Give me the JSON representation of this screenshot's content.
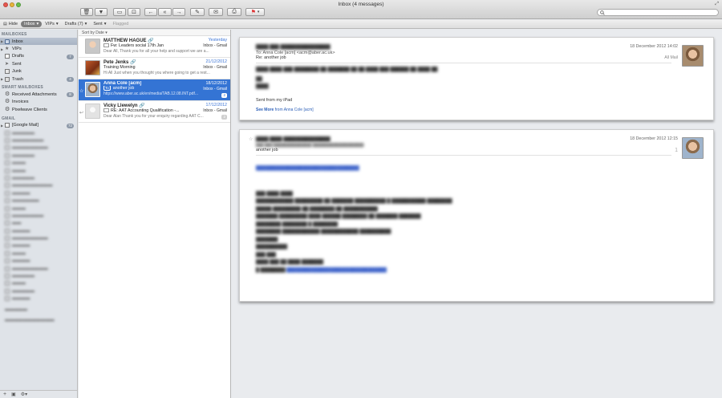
{
  "window": {
    "title": "Inbox (4 messages)"
  },
  "toolbar": {
    "buttons": [
      "delete",
      "junk",
      "archive",
      "archive-box",
      "reply",
      "reply-all",
      "forward",
      "compose",
      "envelope",
      "print",
      "flag"
    ]
  },
  "favorites": {
    "hide": "Hide",
    "inbox": "Inbox",
    "vips": "VIPs",
    "drafts": "Drafts (7)",
    "sent": "Sent",
    "flagged": "Flagged"
  },
  "sidebar": {
    "mailboxes_header": "MAILBOXES",
    "mailboxes": [
      {
        "label": "Inbox",
        "icon": "tray-icon",
        "badge": ""
      },
      {
        "label": "VIPs",
        "icon": "star-icon",
        "badge": ""
      },
      {
        "label": "Drafts",
        "icon": "draft-icon",
        "badge": "7"
      },
      {
        "label": "Sent",
        "icon": "send-icon",
        "badge": ""
      },
      {
        "label": "Junk",
        "icon": "junk-icon",
        "badge": ""
      },
      {
        "label": "Trash",
        "icon": "trash-icon",
        "badge": "4"
      }
    ],
    "smart_header": "SMART MAILBOXES",
    "smart": [
      {
        "label": "Received Attachments",
        "badge": "8"
      },
      {
        "label": "Invoices",
        "badge": ""
      },
      {
        "label": "Pixelwave Clients",
        "badge": ""
      }
    ],
    "gmail_header": "GMAIL",
    "gmail_label": "[Google Mail]",
    "gmail_badge": "72"
  },
  "message_list": {
    "sort_label": "Sort by Date",
    "messages": [
      {
        "from": "MATTHEW HAGUE",
        "date": "Yesterday",
        "subject": "Fw: Leaders social 17th Jan",
        "mailbox": "Inbox - Gmail",
        "preview": "Dear All, Thank you for all your help and support we are a..."
      },
      {
        "from": "Pete Jenks",
        "date": "21/12/2012",
        "subject": "Training Morning",
        "mailbox": "Inbox - Gmail",
        "preview": "Hi All Just when you thought you where going to get a rest..."
      },
      {
        "from": "Anna Cole [acm]",
        "date": "18/12/2012",
        "subject": "another job",
        "mailbox": "Inbox - Gmail",
        "preview": "https://www.aber.ac.uk/en/media/TAB.12.08.INT.pdf...",
        "count": "2",
        "tag": "To"
      },
      {
        "from": "Vicky Llewelyn",
        "date": "17/12/2012",
        "subject": "RE: AAT Accounting Qualification -...",
        "mailbox": "Inbox - Gmail",
        "preview": "Dear Alan Thank you for your enquiry regarding AAT C...",
        "count": "2"
      }
    ]
  },
  "reader": {
    "msg1": {
      "date": "18 December 2012 14:02",
      "to": "To:  Anna Cole [acm] <acm@aber.ac.uk>",
      "subject": "Re: another job",
      "mailbox": "All Mail",
      "signature": "Sent from my iPad",
      "see_more": "See More",
      "see_more_from": "from Anna Cole [acm]"
    },
    "msg2": {
      "date": "18 December 2012 12:15",
      "subject": "another job",
      "count": "1"
    }
  }
}
